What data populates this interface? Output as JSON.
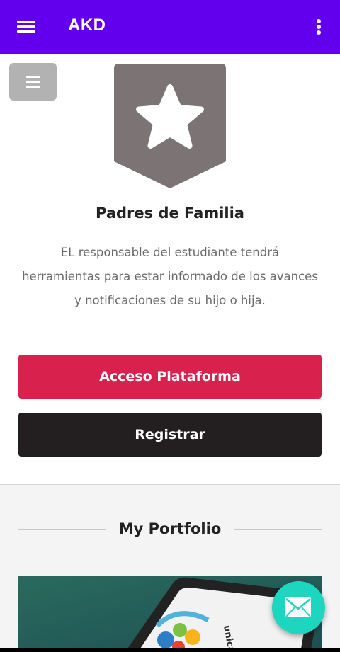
{
  "appbar": {
    "title": "AKD",
    "menu_icon": "hamburger-menu-icon",
    "more_icon": "more-vert-icon",
    "color": "#6200ee"
  },
  "side_toggle": {
    "icon": "hamburger-icon"
  },
  "badge": {
    "icon": "star-icon"
  },
  "section": {
    "heading": "Padres de Familia",
    "description": "EL responsable del estudiante tendrá herramientas para estar informado de los avances y notificaciones de su hijo o hija."
  },
  "buttons": {
    "access_label": "Acceso Plataforma",
    "access_color": "#d9214e",
    "register_label": "Registrar",
    "register_color": "#231f20"
  },
  "portfolio": {
    "title": "My Portfolio",
    "thumb_text": "unicate"
  },
  "fab": {
    "icon": "mail-icon",
    "color": "#1cd6c0"
  }
}
